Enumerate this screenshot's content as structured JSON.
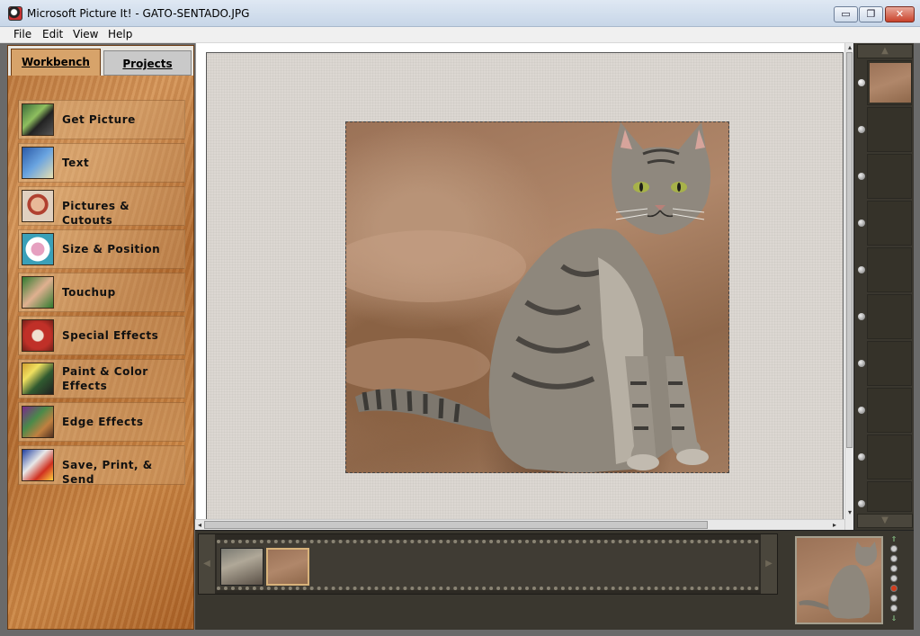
{
  "window": {
    "title": "Microsoft Picture It! - GATO-SENTADO.JPG",
    "controls": {
      "minimize": "▭",
      "maximize": "❐",
      "close": "✕"
    }
  },
  "menu": [
    "File",
    "Edit",
    "View",
    "Help"
  ],
  "tabs": [
    {
      "label": "Workbench",
      "active": true
    },
    {
      "label": "Projects",
      "active": false
    }
  ],
  "workbench_items": [
    {
      "label": "Get Picture",
      "icon": "camera-icon"
    },
    {
      "label": "Text",
      "icon": "text-abc-icon"
    },
    {
      "label": "Pictures & Cutouts",
      "icon": "cutout-child-icon"
    },
    {
      "label": "Size & Position",
      "icon": "frame-resize-icon"
    },
    {
      "label": "Touchup",
      "icon": "touchup-brush-icon"
    },
    {
      "label": "Special Effects",
      "icon": "special-effects-icon"
    },
    {
      "label": "Paint & Color Effects",
      "icon": "paint-color-icon"
    },
    {
      "label": "Edge Effects",
      "icon": "edge-effects-icon"
    },
    {
      "label": "Save, Print, & Send",
      "icon": "save-print-send-icon"
    }
  ],
  "canvas": {
    "image_subject": "photo of a seated tabby cat"
  },
  "right_strip": {
    "up_arrow": "▲",
    "down_arrow": "▼",
    "slots": 10,
    "selected_slot": 0
  },
  "bottom_tray": {
    "left_arrow": "◀",
    "right_arrow": "▶",
    "thumbnails": 2,
    "selected_thumbnail": 1
  },
  "colors": {
    "accent_wood": "#c98545",
    "tray_bg": "#3a372f",
    "close_red": "#c9422b"
  }
}
